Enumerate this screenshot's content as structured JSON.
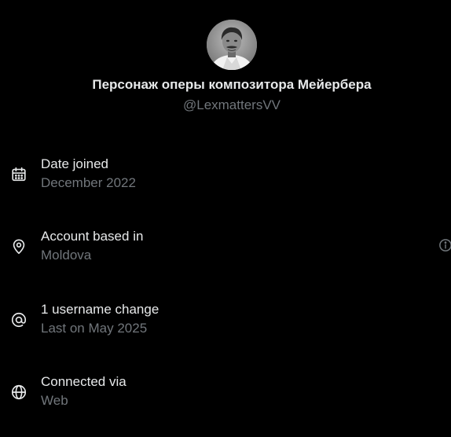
{
  "profile": {
    "display_name": "Персонаж оперы композитора Мейербера",
    "handle": "@LexmattersVV",
    "avatar_icon": "avatar"
  },
  "rows": [
    {
      "icon": "calendar-icon",
      "title": "Date joined",
      "value": "December 2022"
    },
    {
      "icon": "location-pin-icon",
      "title": "Account based in",
      "value": "Moldova",
      "info_icon": "info-icon"
    },
    {
      "icon": "at-sign-icon",
      "title": "1 username change",
      "value": "Last on May 2025"
    },
    {
      "icon": "globe-icon",
      "title": "Connected via",
      "value": "Web"
    }
  ],
  "colors": {
    "background": "#000000",
    "primary_text": "#e7e9ea",
    "secondary_text": "#71767b",
    "icon": "#e7e9ea",
    "info_icon": "#71767b"
  }
}
